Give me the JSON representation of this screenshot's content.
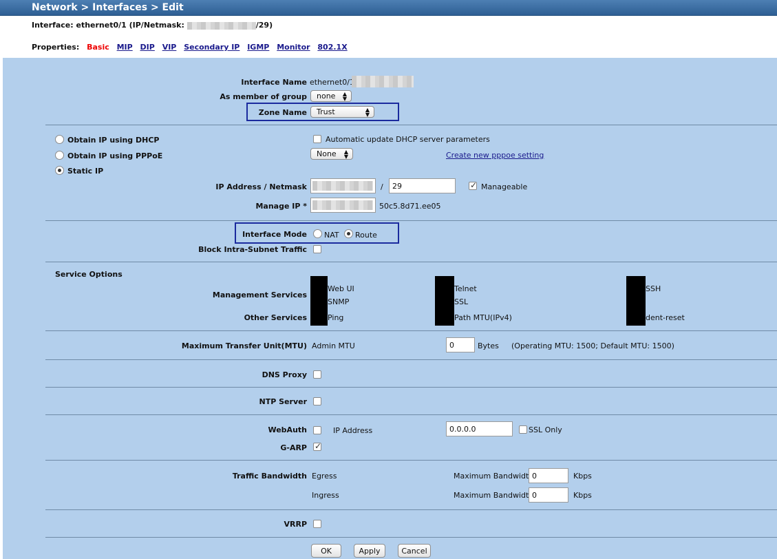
{
  "header": {
    "title": "Network > Interfaces > Edit"
  },
  "interface_line": {
    "prefix": "Interface: ethernet0/1 (IP/Netmask:",
    "suffix": "/29)"
  },
  "properties": {
    "label": "Properties:",
    "tabs": [
      "Basic",
      "MIP",
      "DIP",
      "VIP",
      "Secondary IP",
      "IGMP",
      "Monitor",
      "802.1X"
    ]
  },
  "basic": {
    "interface_name_label": "Interface Name",
    "interface_name_value": "ethernet0/1",
    "member_group_label": "As member of group",
    "member_group_value": "none",
    "zone_name_label": "Zone Name",
    "zone_name_value": "Trust"
  },
  "ip": {
    "dhcp_label": "Obtain IP using DHCP",
    "dhcp_auto_label": "Automatic update DHCP server parameters",
    "pppoe_label": "Obtain IP using PPPoE",
    "pppoe_value": "None",
    "create_pppoe_link": "Create new pppoe setting",
    "static_label": "Static IP",
    "ip_netmask_label": "IP Address / Netmask",
    "slash": "/",
    "netmask_value": "29",
    "manageable_label": "Manageable",
    "manage_ip_label": "Manage IP *",
    "mac_value": "50c5.8d71.ee05"
  },
  "mode": {
    "interface_mode_label": "Interface Mode",
    "nat_label": "NAT",
    "route_label": "Route",
    "block_label": "Block Intra-Subnet Traffic"
  },
  "services": {
    "title": "Service Options",
    "management_label": "Management Services",
    "other_label": "Other Services",
    "web_ui": "Web UI",
    "snmp": "SNMP",
    "ping": "Ping",
    "telnet": "Telnet",
    "ssl": "SSL",
    "path_mtu": "Path MTU(IPv4)",
    "ssh": "SSH",
    "ident_reset": "dent-reset"
  },
  "mtu": {
    "label": "Maximum Transfer Unit(MTU)",
    "admin_label": "Admin MTU",
    "value": "0",
    "unit": "Bytes",
    "info": "(Operating MTU: 1500; Default MTU: 1500)"
  },
  "dns_proxy_label": "DNS Proxy",
  "ntp_server_label": "NTP Server",
  "webauth": {
    "label": "WebAuth",
    "ip_label": "IP Address",
    "ip_value": "0.0.0.0",
    "ssl_only_label": "SSL Only"
  },
  "garp_label": "G-ARP",
  "bandwidth": {
    "label": "Traffic Bandwidth",
    "egress_label": "Egress",
    "ingress_label": "Ingress",
    "max_label": "Maximum Bandwidth",
    "egress_value": "0",
    "ingress_value": "0",
    "unit": "Kbps"
  },
  "vrrp_label": "VRRP",
  "buttons": {
    "ok": "OK",
    "apply": "Apply",
    "cancel": "Cancel"
  },
  "colors": {
    "titlebar": "#3a6ca3",
    "panel": "#b3cfec",
    "highlight_box": "#1a2a9e",
    "active_tab": "#ee0000",
    "link": "#1a1a8c"
  }
}
